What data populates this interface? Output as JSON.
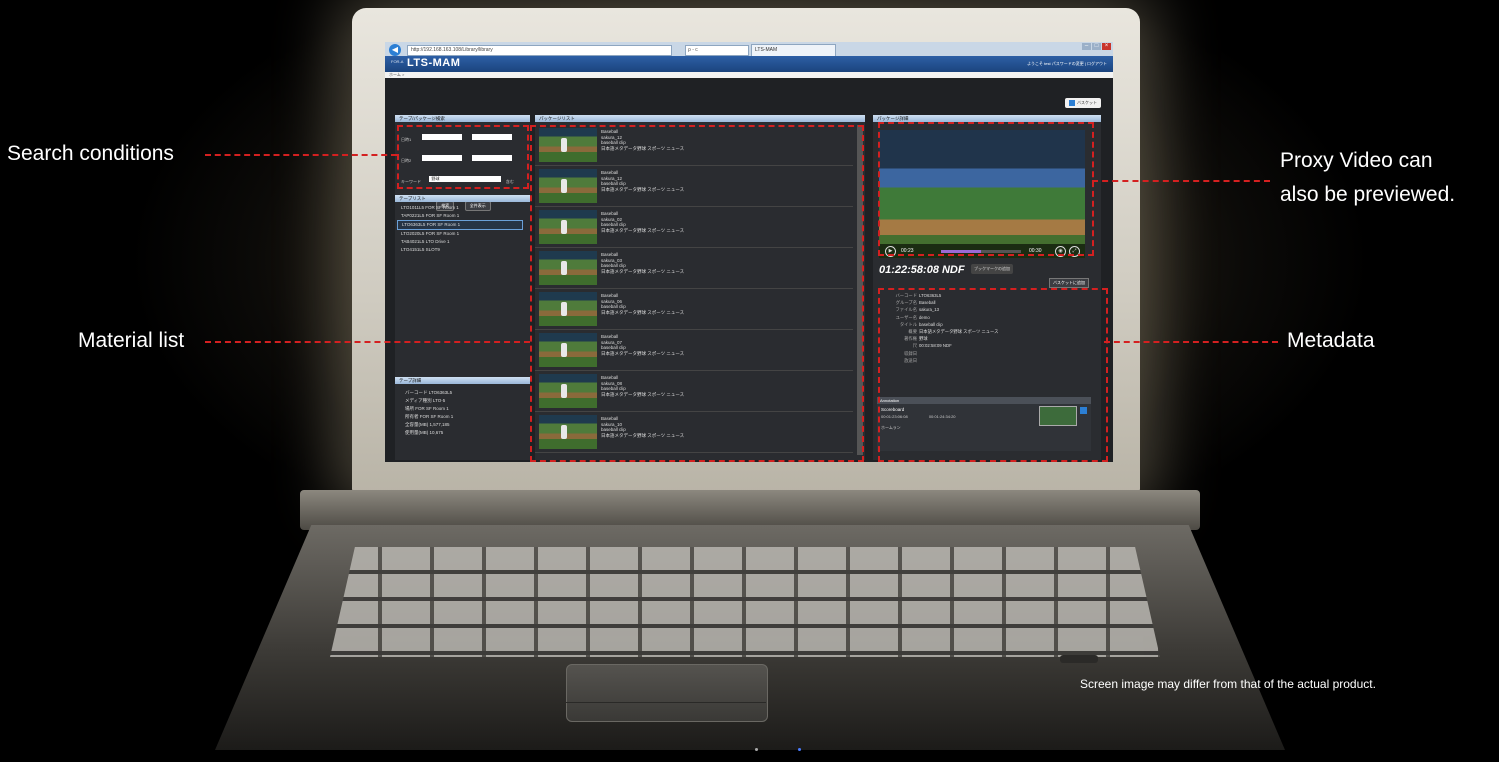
{
  "browser": {
    "url": "http://192.168.163.108/Library/library",
    "search_hint": "ρ - c",
    "tab_title": "LTS-MAM"
  },
  "app": {
    "brand": "FOR-A",
    "name": "LTS-MAM",
    "user_bar": "ようこそ test パスワードの変更 | ログアウト",
    "breadcrumb": "ホーム >",
    "basket_label": "バスケット"
  },
  "search_panel": {
    "title": "テープ/パッケージ検索",
    "date_label_1": "日時1",
    "date_label_2": "日時2",
    "keyword_label": "キーワード",
    "keyword_value": "野球",
    "keyword_option": "含む",
    "search_button": "検索",
    "clear_button": "全件表示"
  },
  "tape_list": {
    "title": "テープリスト",
    "items": [
      "LTO1011L5  FOR SF Room 1",
      "TAP0221L5  FOR SF Room 1",
      "LTO6363L5  FOR SF Room 1",
      "LTO2020L5  FOR SF Room 1",
      "TAB4021L5  LTO Drive 1",
      "LTO4151L5  SLOT9"
    ]
  },
  "tape_detail": {
    "title": "テープ詳細",
    "rows": [
      "バーコード LTO6363L5",
      "メディア種別 LTO-5",
      "場所 FOR SF Room 1",
      "所有者 FOR SF Room 1",
      "全容量(MB) 1,577,185",
      "使用量(MB) 10,675"
    ]
  },
  "package_list": {
    "title": "パッケージリスト",
    "rows": [
      {
        "text": "Baseball\nsakura_12\nbaseball clip\n日本語メタデータ野球 スポーツ ニュース"
      },
      {
        "text": "Baseball\nsakura_12\nbaseball clip\n日本語メタデータ野球 スポーツ ニュース"
      },
      {
        "text": "Baseball\nsakura_02\nbaseball clip\n日本語メタデータ野球 スポーツ ニュース"
      },
      {
        "text": "Baseball\nsakura_03\nbaseball clip\n日本語メタデータ野球 スポーツ ニュース"
      },
      {
        "text": "Baseball\nsakura_06\nbaseball clip\n日本語メタデータ野球 スポーツ ニュース"
      },
      {
        "text": "Baseball\nsakura_07\nbaseball clip\n日本語メタデータ野球 スポーツ ニュース"
      },
      {
        "text": "Baseball\nsakura_08\nbaseball clip\n日本語メタデータ野球 スポーツ ニュース"
      },
      {
        "text": "Baseball\nsakura_10\nbaseball clip\n日本語メタデータ野球 スポーツ ニュース"
      }
    ]
  },
  "package_detail": {
    "title": "パッケージ詳細",
    "time_start": "00:23",
    "time_end": "00:30",
    "progress": 0.5,
    "timecode": "01:22:58:08 NDF",
    "bookmark_button": "ブックマークの追加",
    "add_to_basket": "バスケットに追加",
    "metadata": [
      {
        "k": "バーコード",
        "v": "LTO6363L5"
      },
      {
        "k": "グループ名",
        "v": "Baseball"
      },
      {
        "k": "ファイル名",
        "v": "sakura_13"
      },
      {
        "k": "ユーザー名",
        "v": "demo"
      },
      {
        "k": "タイトル",
        "v": "baseball clip"
      },
      {
        "k": "概要",
        "v": "日本語メタデータ野球 スポーツ ニュース"
      },
      {
        "k": "著作権",
        "v": "野球"
      },
      {
        "k": "尺",
        "v": "00:02:58:09 NDF"
      },
      {
        "k": "収録日",
        "v": ""
      },
      {
        "k": "放送日",
        "v": ""
      }
    ],
    "annotation_title": "Annotation",
    "annotation_name": "Scoreboard",
    "annotation_in": "00:01:23:06:08",
    "annotation_out": "00:01:24:34:20",
    "annotation_second": "ホームラン"
  },
  "callouts": {
    "search": "Search conditions",
    "material": "Material list",
    "proxy_line1": "Proxy Video can",
    "proxy_line2": "also be previewed.",
    "metadata": "Metadata"
  },
  "disclaimer": "Screen image may differ from that of the actual product.",
  "colors": {
    "annotation_red": "#d42020",
    "app_blue": "#1b447e"
  }
}
